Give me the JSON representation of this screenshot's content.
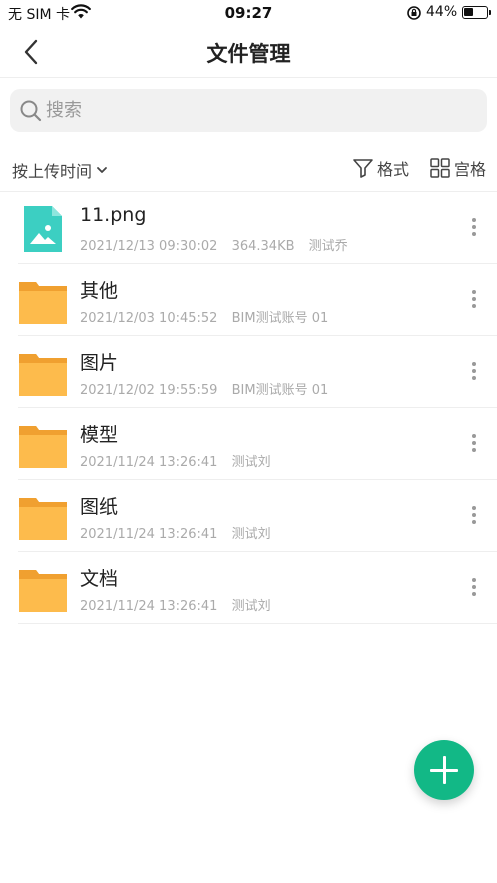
{
  "status_bar": {
    "carrier": "无 SIM 卡",
    "time": "09:27",
    "battery": "44%",
    "battery_level": 0.44
  },
  "nav": {
    "title": "文件管理",
    "back_icon": "chevron-left-icon"
  },
  "search": {
    "placeholder": "搜索",
    "icon": "search-icon"
  },
  "toolbar": {
    "sort_label": "按上传时间",
    "format_label": "格式",
    "grid_label": "宫格"
  },
  "files": [
    {
      "name": "11.png",
      "date": "2021/12/13 09:30:02",
      "size": "364.34KB",
      "owner": "测试乔",
      "type": "image"
    },
    {
      "name": "其他",
      "date": "2021/12/03 10:45:52",
      "owner": "BIM测试账号 01",
      "type": "folder"
    },
    {
      "name": "图片",
      "date": "2021/12/02 19:55:59",
      "owner": "BIM测试账号 01",
      "type": "folder"
    },
    {
      "name": "模型",
      "date": "2021/11/24 13:26:41",
      "owner": "测试刘",
      "type": "folder"
    },
    {
      "name": "图纸",
      "date": "2021/11/24 13:26:41",
      "owner": "测试刘",
      "type": "folder"
    },
    {
      "name": "文档",
      "date": "2021/11/24 13:26:41",
      "owner": "测试刘",
      "type": "folder"
    }
  ],
  "colors": {
    "accent": "#12b886",
    "folder": "#fdbb4c",
    "folder_tab": "#f0a030",
    "image_file": "#3ccfc2"
  },
  "fab_icon": "plus-icon"
}
